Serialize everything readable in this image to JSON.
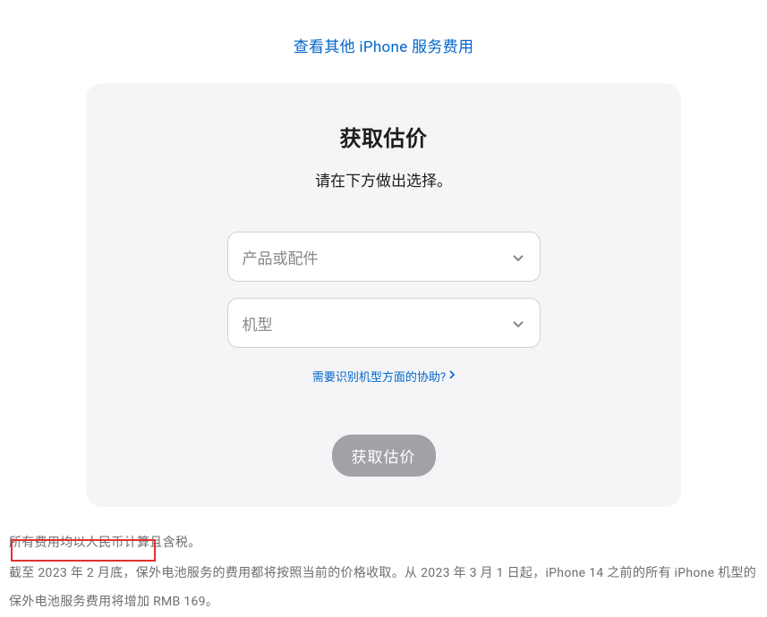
{
  "topLink": {
    "text": "查看其他 iPhone 服务费用"
  },
  "card": {
    "title": "获取估价",
    "subtitle": "请在下方做出选择。",
    "select1": {
      "placeholder": "产品或配件"
    },
    "select2": {
      "placeholder": "机型"
    },
    "helpLink": {
      "text": "需要识别机型方面的协助?"
    },
    "submitButton": {
      "label": "获取估价"
    }
  },
  "footer": {
    "line1": "所有费用均以人民币计算且含税。",
    "line2": "截至 2023 年 2 月底，保外电池服务的费用都将按照当前的价格收取。从 2023 年 3 月 1 日起，iPhone 14 之前的所有 iPhone 机型的保外电池服务费用将增加 RMB 169。"
  }
}
